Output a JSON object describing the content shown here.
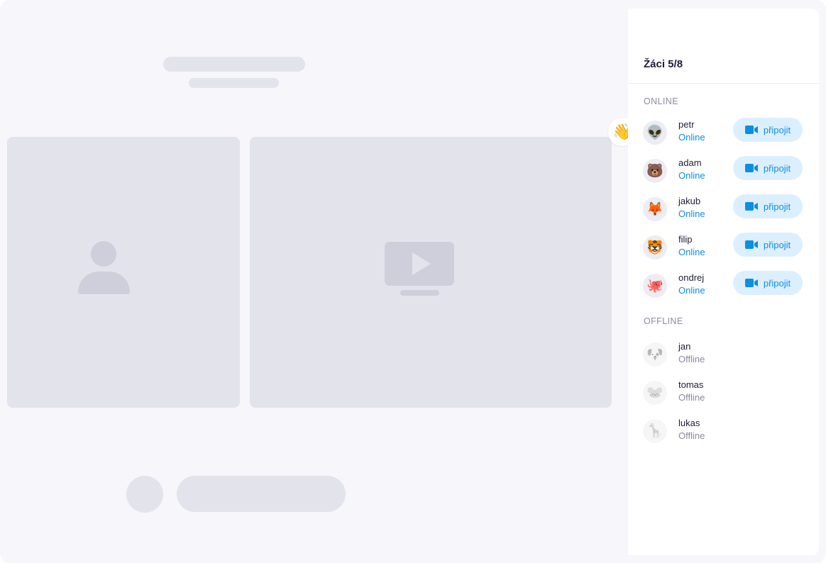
{
  "panel": {
    "title": "Žáci 5/8",
    "online_label": "ONLINE",
    "offline_label": "OFFLINE",
    "join_label": "připojit",
    "wave_icon": "👋"
  },
  "online": [
    {
      "name": "petr",
      "status": "Online",
      "avatar": "👽"
    },
    {
      "name": "adam",
      "status": "Online",
      "avatar": "🐻"
    },
    {
      "name": "jakub",
      "status": "Online",
      "avatar": "🦊"
    },
    {
      "name": "filip",
      "status": "Online",
      "avatar": "🐯"
    },
    {
      "name": "ondrej",
      "status": "Online",
      "avatar": "🐙"
    }
  ],
  "offline": [
    {
      "name": "jan",
      "status": "Offline",
      "avatar": "🐶"
    },
    {
      "name": "tomas",
      "status": "Offline",
      "avatar": "🐭"
    },
    {
      "name": "lukas",
      "status": "Offline",
      "avatar": "🦒"
    }
  ],
  "colors": {
    "accent": "#0d8fe0",
    "join_bg": "#dcefff",
    "skeleton": "#e3e3ec",
    "background": "#f6f6fb"
  }
}
